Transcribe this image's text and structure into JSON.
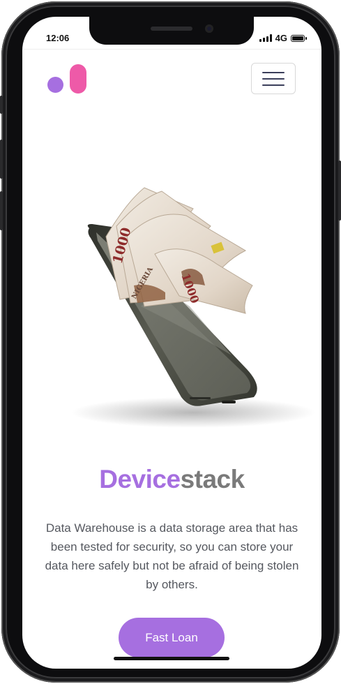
{
  "status_bar": {
    "time": "12:06",
    "network": "4G",
    "signal_icon": "signal-bars-icon",
    "battery_icon": "battery-icon",
    "battery_level": 1.0
  },
  "header": {
    "logo_icon": "devicestack-logo",
    "menu_icon": "hamburger-menu-icon"
  },
  "hero": {
    "image": "phone-with-naira-banknotes-illustration",
    "banknote_text": [
      "1000",
      "1000",
      "NIGERIA"
    ]
  },
  "main": {
    "title_part1": "Device",
    "title_part2": "stack",
    "description": "Data Warehouse is a data storage area that has been tested for security, so you can store your data here safely but not be afraid of being stolen by others.",
    "cta_label": "Fast Loan"
  },
  "colors": {
    "accent": "#a66fe0",
    "pink": "#ee5aa8",
    "text_gray": "#7a7a7a"
  }
}
